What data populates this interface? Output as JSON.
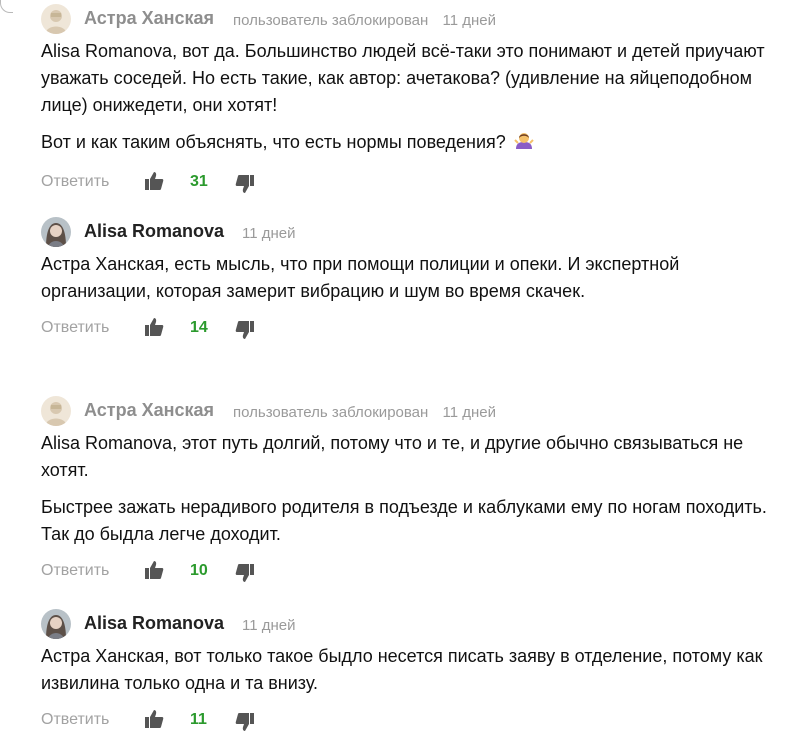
{
  "reply_label": "Ответить",
  "like_color": "#2b9a2d",
  "comments": [
    {
      "author": "Астра Ханская",
      "status": "пользователь заблокирован",
      "time": "11 дней",
      "avatar_icon": "placeholder-avatar-icon",
      "paragraphs": [
        "Alisa Romanova, вот да. Большинство людей всё-таки это понимают и детей приучают уважать соседей. Но есть такие, как автор: ачетакова? (удивление на яйцеподобном лице) онижедети, они хотят!",
        "Вот и как таким объяснять, что есть нормы поведения?"
      ],
      "emoji_icon": "woman-shrugging-icon",
      "likes": "31"
    },
    {
      "author": "Alisa Romanova",
      "status": "",
      "time": "11 дней",
      "avatar_icon": "photo-avatar-icon",
      "paragraphs": [
        "Астра Ханская, есть мысль, что при помощи полиции и опеки. И экспертной организации, которая замерит вибрацию и шум во время скачек."
      ],
      "likes": "14"
    },
    {
      "author": "Астра Ханская",
      "status": "пользователь заблокирован",
      "time": "11 дней",
      "avatar_icon": "placeholder-avatar-icon",
      "paragraphs": [
        "Alisa Romanova, этот путь долгий, потому что и те, и другие обычно связываться не хотят.",
        "Быстрее зажать нерадивого родителя в подъезде и каблуками ему по ногам походить. Так до быдла легче доходит."
      ],
      "likes": "10"
    },
    {
      "author": "Alisa Romanova",
      "status": "",
      "time": "11 дней",
      "avatar_icon": "photo-avatar-icon",
      "paragraphs": [
        "Астра Ханская, вот только такое быдло несется писать заяву в отделение, потому как извилина только одна и та внизу."
      ],
      "likes": "11"
    }
  ]
}
